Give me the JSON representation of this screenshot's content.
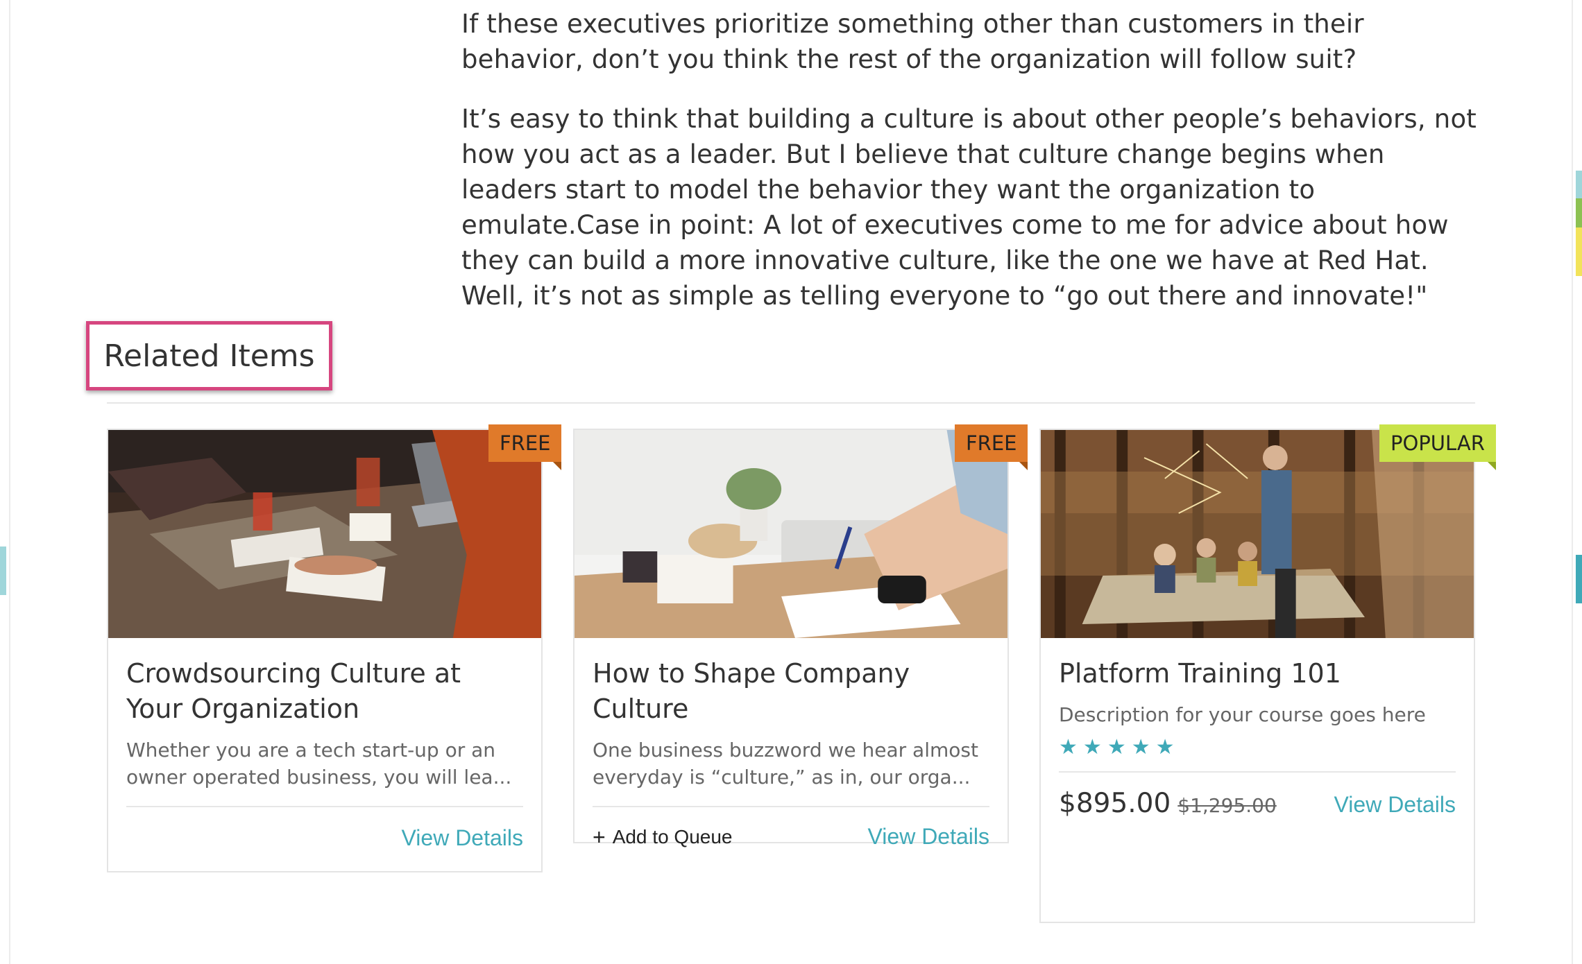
{
  "article": {
    "paragraph_1": "If these executives prioritize something other than customers in their behavior, don’t you think the rest of the organization will follow suit?",
    "paragraph_2": "It’s easy to think that building a culture is about other people’s behaviors, not how you act as a leader. But I believe that culture change begins when leaders start to model the behavior they want the organization to emulate.Case in point: A lot of executives come to me for advice about how they can build a more innovative culture, like the one we have at Red Hat. Well, it’s not as simple as telling everyone to “go out there and innovate!\""
  },
  "related": {
    "title": "Related Items",
    "cards": [
      {
        "badge": "FREE",
        "title": "Crowdsourcing Culture at Your Organization",
        "description": "Whether you are a tech start-up or an owner operated business, you will lea...",
        "view_details": "View Details"
      },
      {
        "badge": "FREE",
        "title": "How to Shape Company Culture",
        "description": "One business buzzword we hear almost everyday is “culture,” as in, our orga...",
        "add_to_queue": "Add to Queue",
        "view_details": "View Details"
      },
      {
        "badge": "POPULAR",
        "title": "Platform Training 101",
        "description": "Description for your course goes here",
        "rating": 5,
        "price": "$895.00",
        "original_price": "$1,295.00",
        "view_details": "View Details"
      }
    ]
  },
  "colors": {
    "accent": "#3fa9b8",
    "highlight_border": "#d6467f",
    "badge_free": "#e07a2a",
    "badge_popular": "#c9e34a"
  }
}
